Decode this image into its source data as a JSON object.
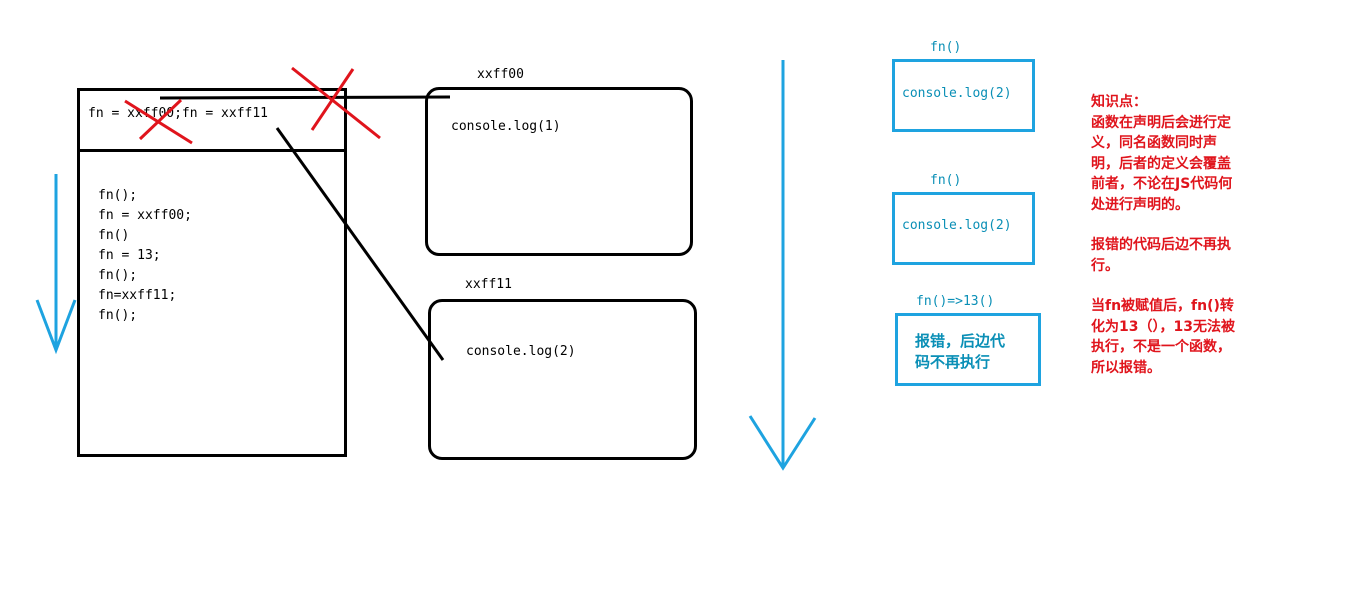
{
  "stack": {
    "header": "fn = xxff00;fn = xxff11",
    "code": [
      "fn();",
      "fn = xxff00;",
      "fn()",
      "fn = 13;",
      "fn();",
      "fn=xxff11;",
      "fn();"
    ]
  },
  "heaps": [
    {
      "address": "xxff00",
      "content": "console.log(1)"
    },
    {
      "address": "xxff11",
      "content": "console.log(2)"
    }
  ],
  "exec": [
    {
      "label": "fn()",
      "content": "console.log(2)"
    },
    {
      "label": "fn()",
      "content": "console.log(2)"
    },
    {
      "label": "fn()=>13()",
      "content_line1": "报错，后边代",
      "content_line2": "码不再执行"
    }
  ],
  "notes": {
    "title": "知识点：",
    "p1": [
      "函数在声明后会进行定",
      "义，同名函数同时声",
      "明，后者的定义会覆盖",
      "前者，不论在JS代码何",
      "处进行声明的。"
    ],
    "p2": [
      "报错的代码后边不再执",
      "行。"
    ],
    "p3": [
      "当fn被赋值后，fn()转",
      "化为13（），13无法被",
      "执行，不是一个函数，",
      "所以报错。"
    ]
  },
  "colors": {
    "red": "#e0141c",
    "blue": "#1ea3e0",
    "black": "#000000"
  }
}
